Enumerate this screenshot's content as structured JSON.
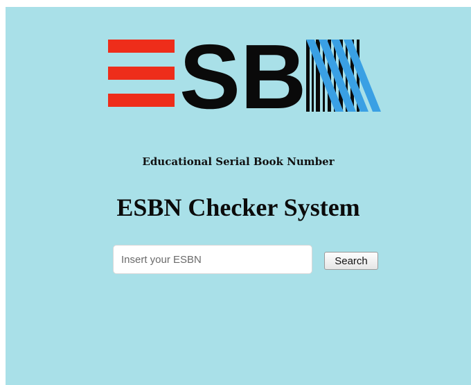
{
  "logo": {
    "text": "ESBN",
    "colors": {
      "red": "#ee2d1a",
      "black": "#0a0a0a",
      "blue": "#3aa0e4"
    }
  },
  "header": {
    "subtitle": "Educational Serial Book Number",
    "title": "ESBN Checker System"
  },
  "search": {
    "placeholder": "Insert your ESBN",
    "value": "",
    "button_label": "Search"
  },
  "theme": {
    "background": "#a9e0e8"
  }
}
